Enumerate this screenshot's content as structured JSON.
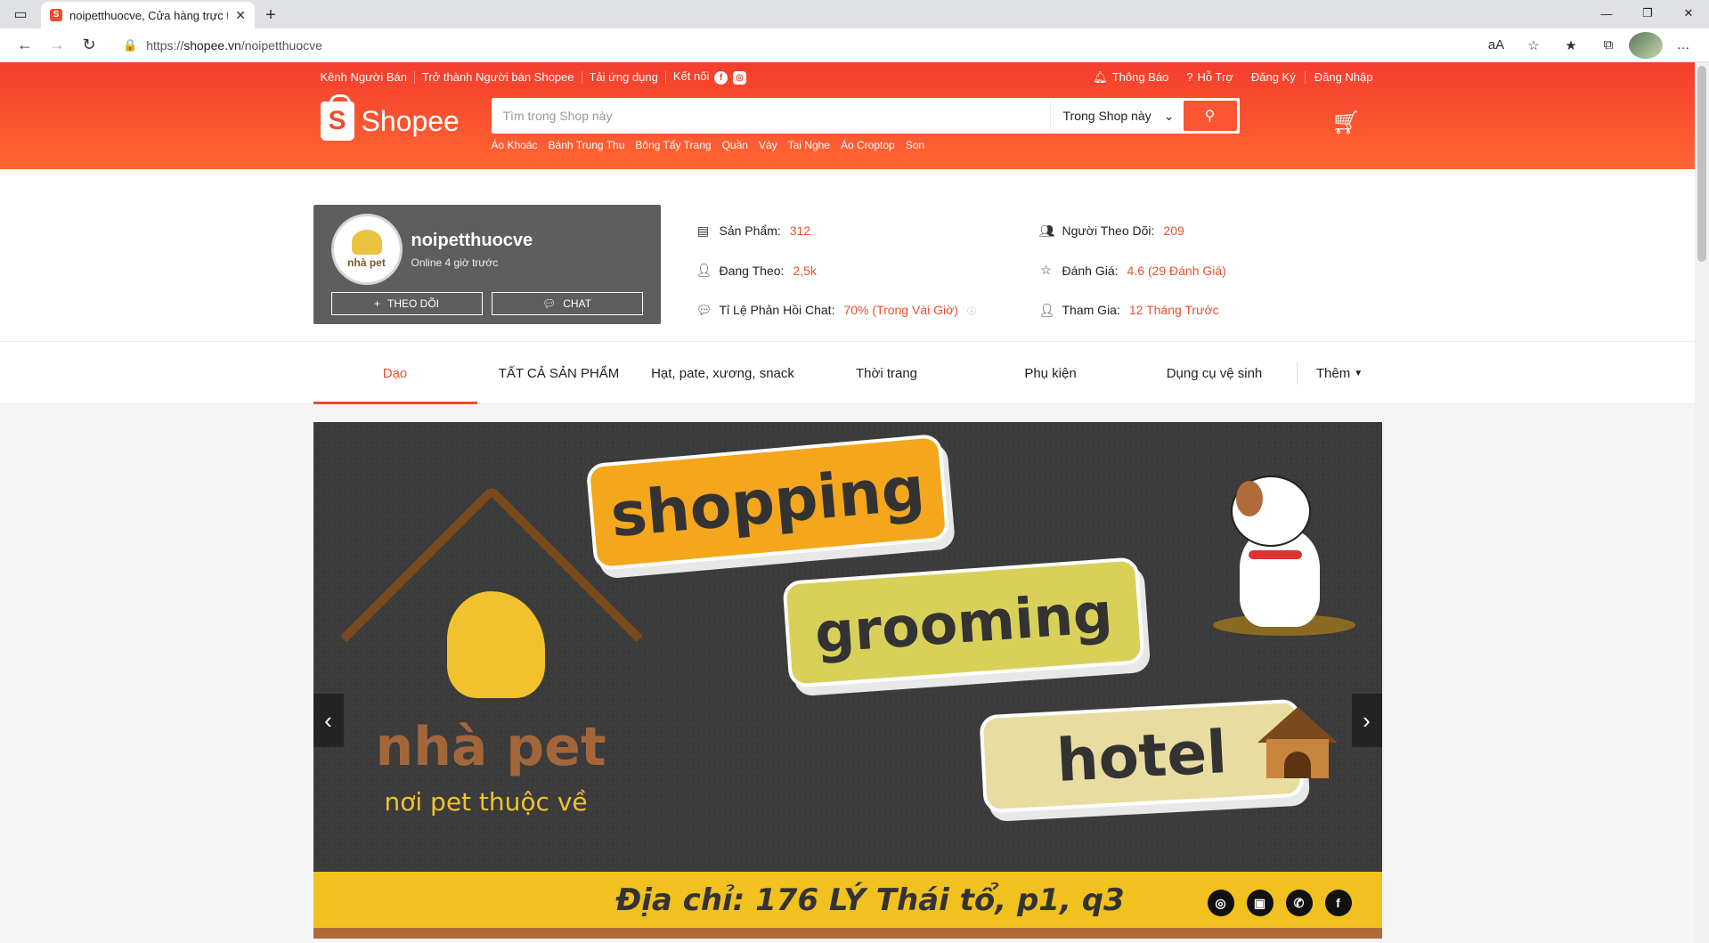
{
  "browser": {
    "tab_title": "noipetthuocve, Cửa hàng trực tuyến",
    "url_prefix": "https://",
    "url_host": "shopee.vn",
    "url_path": "/noipetthuocve"
  },
  "topnav": {
    "left": [
      "Kênh Người Bán",
      "Trở thành Người bán Shopee",
      "Tải ứng dụng",
      "Kết nối"
    ],
    "notifications": "Thông Báo",
    "help": "Hỗ Trợ",
    "register": "Đăng Ký",
    "login": "Đăng Nhập"
  },
  "logo": {
    "text": "Shopee"
  },
  "search": {
    "placeholder": "Tìm trong Shop này",
    "scope": "Trong Shop này",
    "keywords": [
      "Áo Khoác",
      "Bánh Trung Thu",
      "Bông Tẩy Trang",
      "Quần",
      "Váy",
      "Tai Nghe",
      "Áo Croptop",
      "Son"
    ]
  },
  "shop": {
    "name": "noipetthuocve",
    "status": "Online 4 giờ trước",
    "avatar_text": "nhà pet",
    "follow_label": "THEO DÕI",
    "chat_label": "CHAT"
  },
  "stats": {
    "products_label": "Sản Phẩm:",
    "products_value": "312",
    "followers_label": "Người Theo Dõi:",
    "followers_value": "209",
    "following_label": "Đang Theo:",
    "following_value": "2,5k",
    "rating_label": "Đánh Giá:",
    "rating_value": "4.6 (29 Đánh Giá)",
    "chat_rate_label": "Tỉ Lệ Phản Hồi Chat:",
    "chat_rate_value": "70% (Trong Vài Giờ)",
    "joined_label": "Tham Gia:",
    "joined_value": "12 Tháng Trước"
  },
  "tabs": [
    "Dạo",
    "TẤT CẢ SẢN PHẨM",
    "Hạt, pate, xương, snack",
    "Thời trang",
    "Phụ kiện",
    "Dụng cụ vệ sinh"
  ],
  "tabs_more": "Thêm",
  "banner": {
    "brand_name": "nhà pet",
    "brand_sub": "nơi pet thuộc về",
    "plate1": "shopping",
    "plate2": "grooming",
    "plate3": "hotel",
    "address": "Địa chỉ: 176 LÝ Thái tổ, p1, q3"
  },
  "colors": {
    "accent": "#ee4d2d",
    "header_start": "#f53d2d",
    "header_end": "#ff6633"
  }
}
